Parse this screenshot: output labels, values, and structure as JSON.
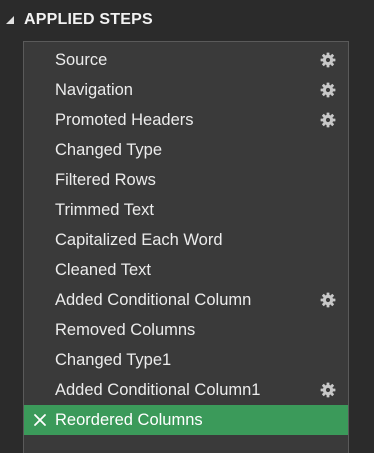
{
  "header": {
    "title": "APPLIED STEPS"
  },
  "steps": [
    {
      "label": "Source",
      "has_settings": true
    },
    {
      "label": "Navigation",
      "has_settings": true
    },
    {
      "label": "Promoted Headers",
      "has_settings": true
    },
    {
      "label": "Changed Type",
      "has_settings": false
    },
    {
      "label": "Filtered Rows",
      "has_settings": false
    },
    {
      "label": "Trimmed Text",
      "has_settings": false
    },
    {
      "label": "Capitalized Each Word",
      "has_settings": false
    },
    {
      "label": "Cleaned Text",
      "has_settings": false
    },
    {
      "label": "Added Conditional Column",
      "has_settings": true
    },
    {
      "label": "Removed Columns",
      "has_settings": false
    },
    {
      "label": "Changed Type1",
      "has_settings": false
    },
    {
      "label": "Added Conditional Column1",
      "has_settings": true
    },
    {
      "label": "Reordered Columns",
      "has_settings": false,
      "selected": true
    }
  ],
  "colors": {
    "background": "#2b2b2b",
    "panel": "#3a3a3a",
    "selected": "#3b9a5a",
    "gear": "#c8c8c8"
  },
  "icons": {
    "collapse": "triangle-collapse-icon",
    "settings": "gear-icon",
    "delete": "delete-x-icon"
  }
}
